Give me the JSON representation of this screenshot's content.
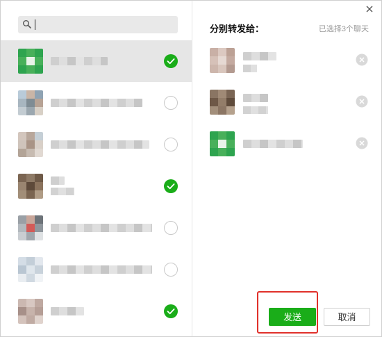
{
  "search": {
    "placeholder": "",
    "value": ""
  },
  "dialog": {
    "title": "分别转发给：",
    "selected_count_text": "已选择3个聊天",
    "send_label": "发送",
    "cancel_label": "取消"
  },
  "contacts": [
    {
      "label": "",
      "checked": true,
      "avatar_colors": [
        "#2ea44f",
        "#48b05a",
        "#2ea44f",
        "#48b05a",
        "#e8f3e8",
        "#48b05a",
        "#2ea44f",
        "#48b05a",
        "#2ea44f"
      ]
    },
    {
      "label": "",
      "checked": false,
      "avatar_colors": [
        "#b9cbd9",
        "#c9b5a6",
        "#8fa3b3",
        "#a8b6c0",
        "#7f8c94",
        "#b7a395",
        "#c3ccd2",
        "#9ba7af",
        "#d8d0c6"
      ]
    },
    {
      "label": "",
      "checked": false,
      "avatar_colors": [
        "#d3c6bd",
        "#b8a79b",
        "#c5cfd6",
        "#cfc4bb",
        "#a99486",
        "#d9d0c8",
        "#b3a497",
        "#c7bbb1",
        "#e1d9d2"
      ]
    },
    {
      "label": "",
      "checked": true,
      "avatar_colors": [
        "#7b6552",
        "#8e7a66",
        "#6f5a48",
        "#9a8570",
        "#5e4a3a",
        "#8b735d",
        "#a28e78",
        "#7a6450",
        "#b09c86"
      ]
    },
    {
      "label": "",
      "checked": false,
      "avatar_colors": [
        "#9aa0a6",
        "#c8a69a",
        "#6d7379",
        "#b3b9be",
        "#d35b58",
        "#8f969c",
        "#c9cdd1",
        "#a1a7ad",
        "#dfe2e4"
      ]
    },
    {
      "label": "",
      "checked": false,
      "avatar_colors": [
        "#d4dde6",
        "#c3ced8",
        "#e3e8ee",
        "#b9c6d2",
        "#dfe6ec",
        "#c8d2db",
        "#e9edf1",
        "#d0d9e1",
        "#f0f3f6"
      ]
    },
    {
      "label": "",
      "checked": true,
      "avatar_colors": [
        "#cbb8b1",
        "#d8c8c2",
        "#bfa9a1",
        "#a79089",
        "#c7b3ab",
        "#b59e96",
        "#d4c3bc",
        "#c0aba3",
        "#e0d3cd"
      ]
    }
  ],
  "selected": [
    {
      "label": "",
      "avatar_colors": [
        "#c9b0a6",
        "#dcc9c1",
        "#bca195",
        "#d6c1b8",
        "#e6d9d3",
        "#c4aaa0",
        "#cdb6ac",
        "#d9c6bd",
        "#b39a90"
      ]
    },
    {
      "label": "",
      "avatar_colors": [
        "#8a7563",
        "#a08a76",
        "#7a6554",
        "#6e5847",
        "#937d69",
        "#5f4b3b",
        "#a38f7b",
        "#8c7664",
        "#b5a18d"
      ]
    },
    {
      "label": "",
      "avatar_colors": [
        "#2ea44f",
        "#48b05a",
        "#2ea44f",
        "#48b05a",
        "#e8f3e8",
        "#48b05a",
        "#2ea44f",
        "#48b05a",
        "#2ea44f"
      ]
    }
  ],
  "colors": {
    "accent": "#1aad19",
    "highlight": "#e0302a",
    "row_active": "#e6e6e6"
  }
}
